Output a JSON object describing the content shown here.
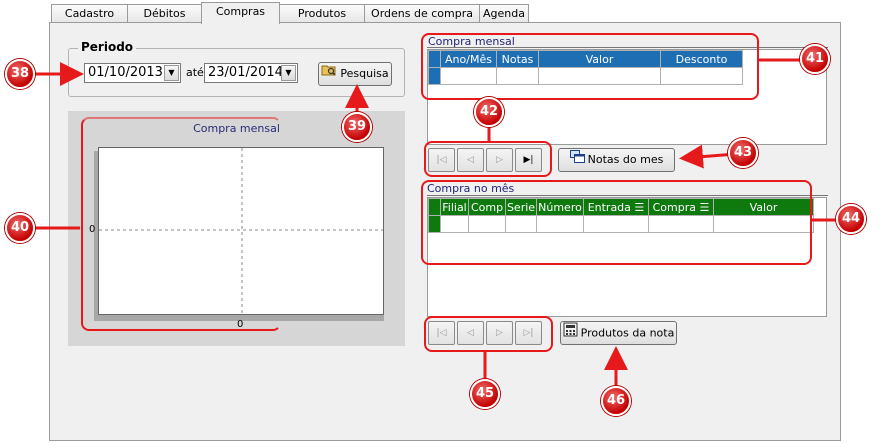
{
  "tabs": [
    {
      "label": "Cadastro",
      "active": false
    },
    {
      "label": "Débitos",
      "active": false
    },
    {
      "label": "Compras",
      "active": true
    },
    {
      "label": "Produtos",
      "active": false
    },
    {
      "label": "Ordens de compra",
      "active": false
    },
    {
      "label": "Agenda",
      "active": false
    }
  ],
  "periodo": {
    "title": "Periodo",
    "start_date": "01/10/2013",
    "separator": "até",
    "end_date": "23/01/2014",
    "search_label": "Pesquisa"
  },
  "chart": {
    "title": "Compra  mensal",
    "y_tick": "0",
    "x_tick": "0"
  },
  "chart_data": {
    "type": "bar",
    "title": "Compra  mensal",
    "categories": [
      "0"
    ],
    "values": [
      0
    ],
    "ylim": [
      0,
      0
    ],
    "grid": true
  },
  "compra_mensal": {
    "title": "Compra mensal",
    "columns": [
      "Ano/Mês",
      "Notas",
      "Valor",
      "Desconto"
    ],
    "header_color": "#1E6EB4",
    "notas_button_label": "Notas do mes"
  },
  "compra_no_mes": {
    "title": "Compra no mês",
    "columns": [
      "Filial",
      "Comp",
      "Serie",
      "Número",
      "Entrada",
      "Compra",
      "Valor"
    ],
    "header_color": "#0E7A0E",
    "produtos_button_label": "Produtos da nota"
  },
  "annotations": {
    "n38": "38",
    "n39": "39",
    "n40": "40",
    "n41": "41",
    "n42": "42",
    "n43": "43",
    "n44": "44",
    "n45": "45",
    "n46": "46",
    "color": "#E61A1A"
  }
}
